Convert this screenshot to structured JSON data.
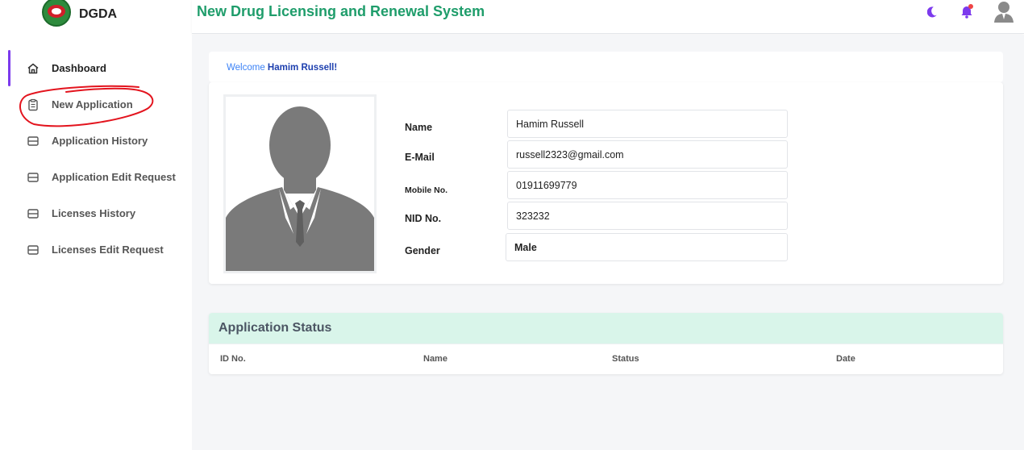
{
  "brand": {
    "name": "DGDA"
  },
  "header": {
    "title": "New Drug Licensing and Renewal System"
  },
  "sidebar": {
    "items": [
      {
        "label": "Dashboard"
      },
      {
        "label": "New Application"
      },
      {
        "label": "Application History"
      },
      {
        "label": "Application Edit Request"
      },
      {
        "label": "Licenses History"
      },
      {
        "label": "Licenses Edit Request"
      }
    ]
  },
  "welcome": {
    "prefix": "Welcome",
    "user": "Hamim Russell!"
  },
  "profile": {
    "name_label": "Name",
    "name_value": "Hamim Russell",
    "email_label": "E-Mail",
    "email_value": "russell2323@gmail.com",
    "mobile_label": "Mobile No.",
    "mobile_value": "01911699779",
    "nid_label": "NID No.",
    "nid_value": "323232",
    "gender_label": "Gender",
    "gender_value": "Male"
  },
  "status": {
    "title": "Application Status",
    "columns": [
      "ID No.",
      "Name",
      "Status",
      "Date"
    ]
  },
  "colors": {
    "accent": "#7c3aed",
    "title_green": "#1f9d6b",
    "status_header_bg": "#d9f5ea",
    "notification": "#7c3aed",
    "notification_dot": "#ef4444",
    "annotation_red": "#e3141e"
  },
  "icons": {
    "theme": "moon-icon",
    "notifications": "bell-icon",
    "user": "user-avatar-icon"
  }
}
